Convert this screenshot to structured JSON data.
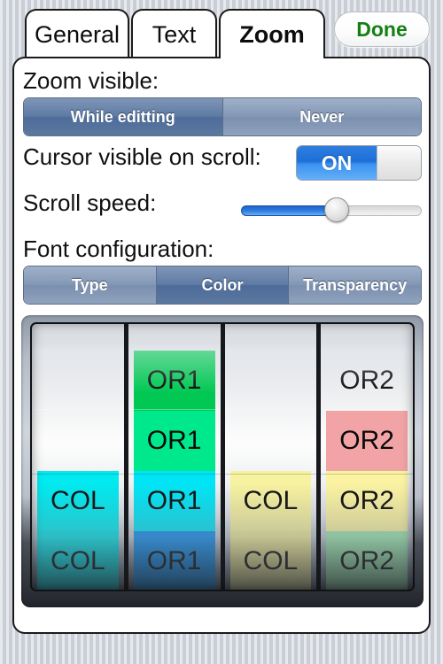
{
  "tabs": [
    {
      "label": "General",
      "selected": false
    },
    {
      "label": "Text",
      "selected": false
    },
    {
      "label": "Zoom",
      "selected": true
    }
  ],
  "done_button": {
    "label": "Done"
  },
  "sections": {
    "zoom_visible": {
      "label": "Zoom visible:",
      "options": [
        "While editting",
        "Never"
      ],
      "selected": "While editting"
    },
    "cursor_visible": {
      "label": "Cursor visible on scroll:",
      "toggle_state": "ON"
    },
    "scroll_speed": {
      "label": "Scroll speed:",
      "value_percent": 50
    },
    "font_configuration": {
      "label": "Font configuration:",
      "options": [
        "Type",
        "Color",
        "Transparency"
      ],
      "selected": "Color"
    }
  },
  "colors": {
    "accent_blue": "#2f7ce0",
    "done_green": "#138012",
    "segment_selected": "#4d6c99",
    "segment_unselected": "#8498b6"
  },
  "picker": {
    "columns": [
      {
        "name": "column-1",
        "cells": [
          {
            "text": "",
            "color": "transparent"
          },
          {
            "text": "",
            "color": "transparent"
          },
          {
            "text": "COL",
            "color": "#00eaf0"
          },
          {
            "text": "COL",
            "color": "#00e2e8"
          },
          {
            "text": "COL",
            "color": "#00d4da"
          }
        ]
      },
      {
        "name": "column-2",
        "cells": [
          {
            "text": "OR1",
            "color": "#00c853"
          },
          {
            "text": "OR1",
            "color": "#00e88c"
          },
          {
            "text": "OR1",
            "color": "#00e5f5"
          },
          {
            "text": "OR1",
            "color": "#0f8ef0"
          },
          {
            "text": "OR1",
            "color": "#0d48d8"
          }
        ]
      },
      {
        "name": "column-3",
        "cells": [
          {
            "text": "",
            "color": "transparent"
          },
          {
            "text": "",
            "color": "transparent"
          },
          {
            "text": "COL",
            "color": "#f7f2a0"
          },
          {
            "text": "COL",
            "color": "#f2eb96"
          },
          {
            "text": "COL",
            "color": "#ece58c"
          }
        ]
      },
      {
        "name": "column-4",
        "cells": [
          {
            "text": "OR2",
            "color": "transparent"
          },
          {
            "text": "OR2",
            "color": "#f2a3a5"
          },
          {
            "text": "OR2",
            "color": "#fbf3a2"
          },
          {
            "text": "OR2",
            "color": "#9ce8ac"
          },
          {
            "text": "OR2",
            "color": "#93cfdd"
          }
        ]
      }
    ]
  }
}
